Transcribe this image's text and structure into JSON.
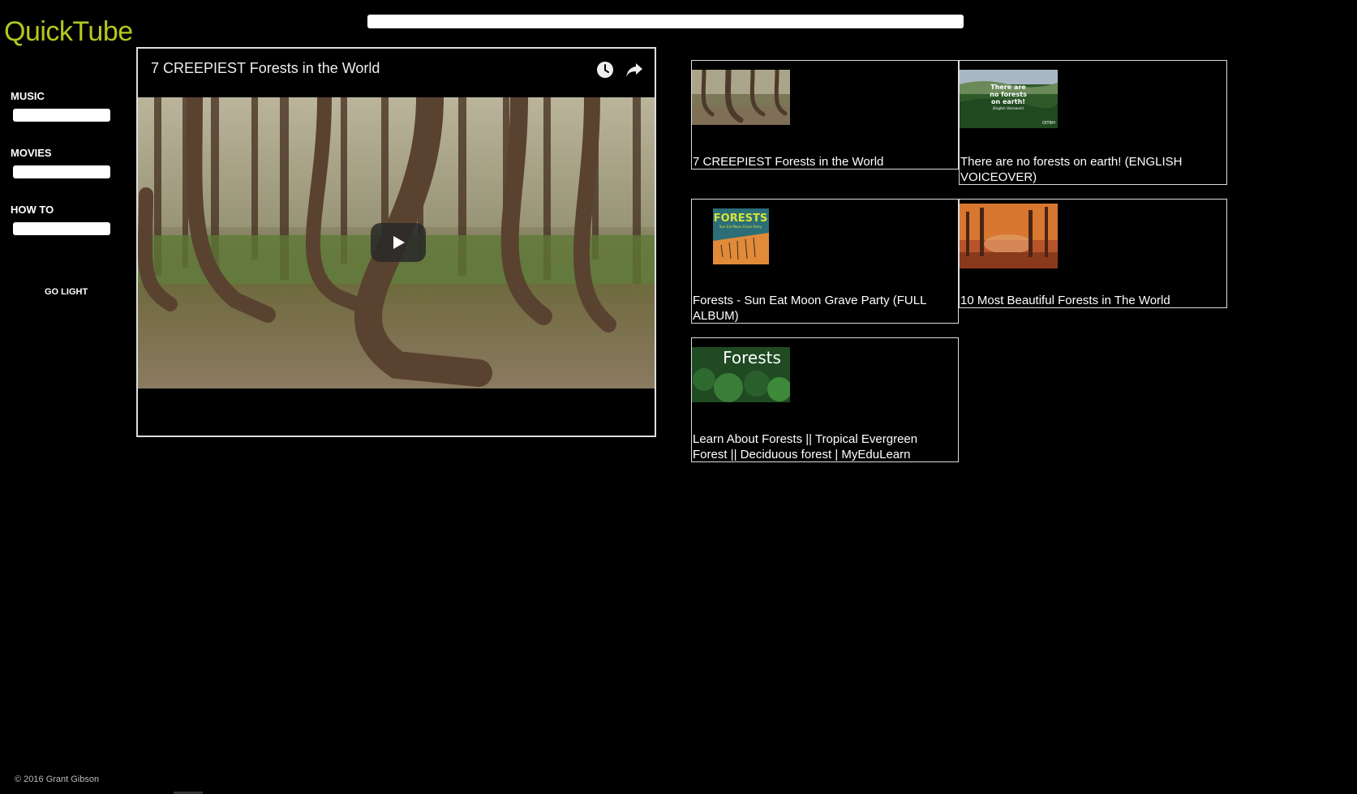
{
  "app": {
    "logo": "QuickTube",
    "search_placeholder": ""
  },
  "sidebar": {
    "categories": [
      {
        "label": "MUSIC",
        "value": ""
      },
      {
        "label": "MOVIES",
        "value": ""
      },
      {
        "label": "HOW TO",
        "value": ""
      }
    ],
    "theme_toggle": "GO LIGHT",
    "footer": "© 2016 Grant Gibson"
  },
  "player": {
    "title": "7 CREEPIEST Forests in the World",
    "icons": [
      "watch-later-icon",
      "share-icon"
    ]
  },
  "results": [
    {
      "title": "7 CREEPIEST Forests in the World",
      "thumb": "curved-trees"
    },
    {
      "title": "There are no forests on earth! (ENGLISH VOICEOVER)",
      "thumb": "forest-hills",
      "thumb_text": [
        "There are",
        "no forests",
        "on earth!",
        "(English Voiceover)",
        "OITRH"
      ]
    },
    {
      "title": "Forests - Sun Eat Moon Grave Party (FULL ALBUM)",
      "thumb": "album-cover",
      "thumb_text": [
        "FORESTS",
        "Sun Eat Moon Grave Party"
      ]
    },
    {
      "title": "10 Most Beautiful Forests in The World",
      "thumb": "autumn-forest"
    },
    {
      "title": "Learn About Forests || Tropical Evergreen Forest || Deciduous forest | MyEduLearn",
      "thumb": "green-forest",
      "thumb_text": [
        "Forests"
      ]
    }
  ],
  "colors": {
    "background": "#000000",
    "logo": "#b5c71c",
    "text": "#ffffff"
  }
}
